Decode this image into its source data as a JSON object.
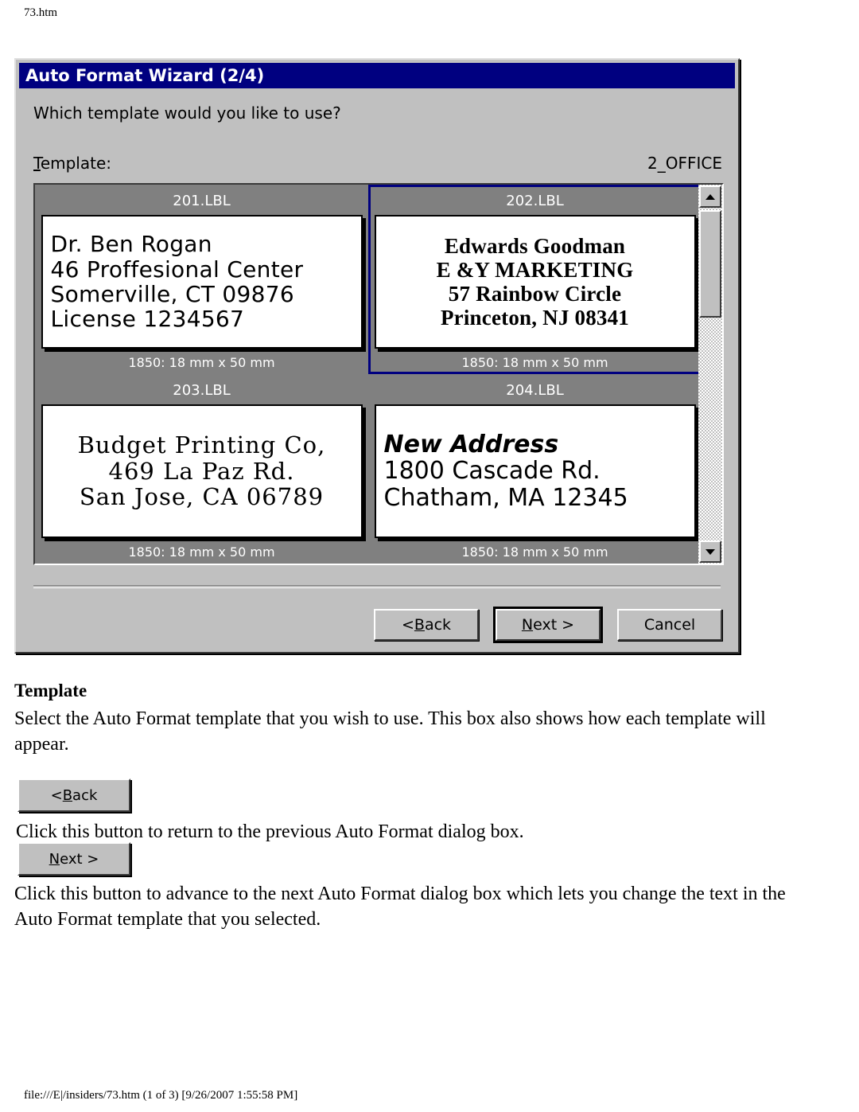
{
  "page": {
    "header_filename": "73.htm",
    "footer": "file:///E|/insiders/73.htm (1 of 3) [9/26/2007 1:55:58 PM]"
  },
  "dialog": {
    "title": "Auto Format Wizard (2/4)",
    "prompt": "Which template would you like to use?",
    "field_label_prefix": "T",
    "field_label_rest": "emplate:",
    "template_name": "2_OFFICE",
    "titlebar_color": "#000080",
    "face_color": "#c0c0c0",
    "list_bg_color": "#808080",
    "selection_color": "#000080"
  },
  "templates": [
    {
      "name": "201.LBL",
      "size": "1850: 18 mm x 50 mm",
      "selected": false,
      "lines": [
        "Dr. Ben Rogan",
        "46 Proffesional Center",
        "Somerville, CT 09876",
        "License 1234567"
      ]
    },
    {
      "name": "202.LBL",
      "size": "1850: 18 mm x 50 mm",
      "selected": true,
      "lines": [
        "Edwards Goodman",
        "E &Y MARKETING",
        "57 Rainbow Circle",
        "Princeton, NJ 08341"
      ]
    },
    {
      "name": "203.LBL",
      "size": "1850: 18 mm x 50 mm",
      "selected": false,
      "lines": [
        "Budget Printing Co,",
        "469 La Paz Rd.",
        "San Jose, CA 06789"
      ]
    },
    {
      "name": "204.LBL",
      "size": "1850: 18 mm x 50 mm",
      "selected": false,
      "lines": [
        "New Address",
        "1800 Cascade Rd.",
        "Chatham, MA 12345"
      ]
    }
  ],
  "buttons": {
    "back": {
      "pre": "< ",
      "accel": "B",
      "post": "ack"
    },
    "next": {
      "pre": "",
      "accel": "N",
      "post": "ext >"
    },
    "cancel": {
      "label": "Cancel"
    }
  },
  "scrollbar": {
    "up_arrow": "scroll-up-arrow",
    "down_arrow": "scroll-down-arrow"
  },
  "prose": {
    "heading": "Template",
    "description": "Select the Auto Format template that you wish to use. This box also shows how each template will appear.",
    "back_description": "Click this button to return to the previous Auto Format dialog box.",
    "next_description": "Click this button to advance to the next Auto Format dialog box which lets you change the text in the Auto Format template that you selected."
  }
}
